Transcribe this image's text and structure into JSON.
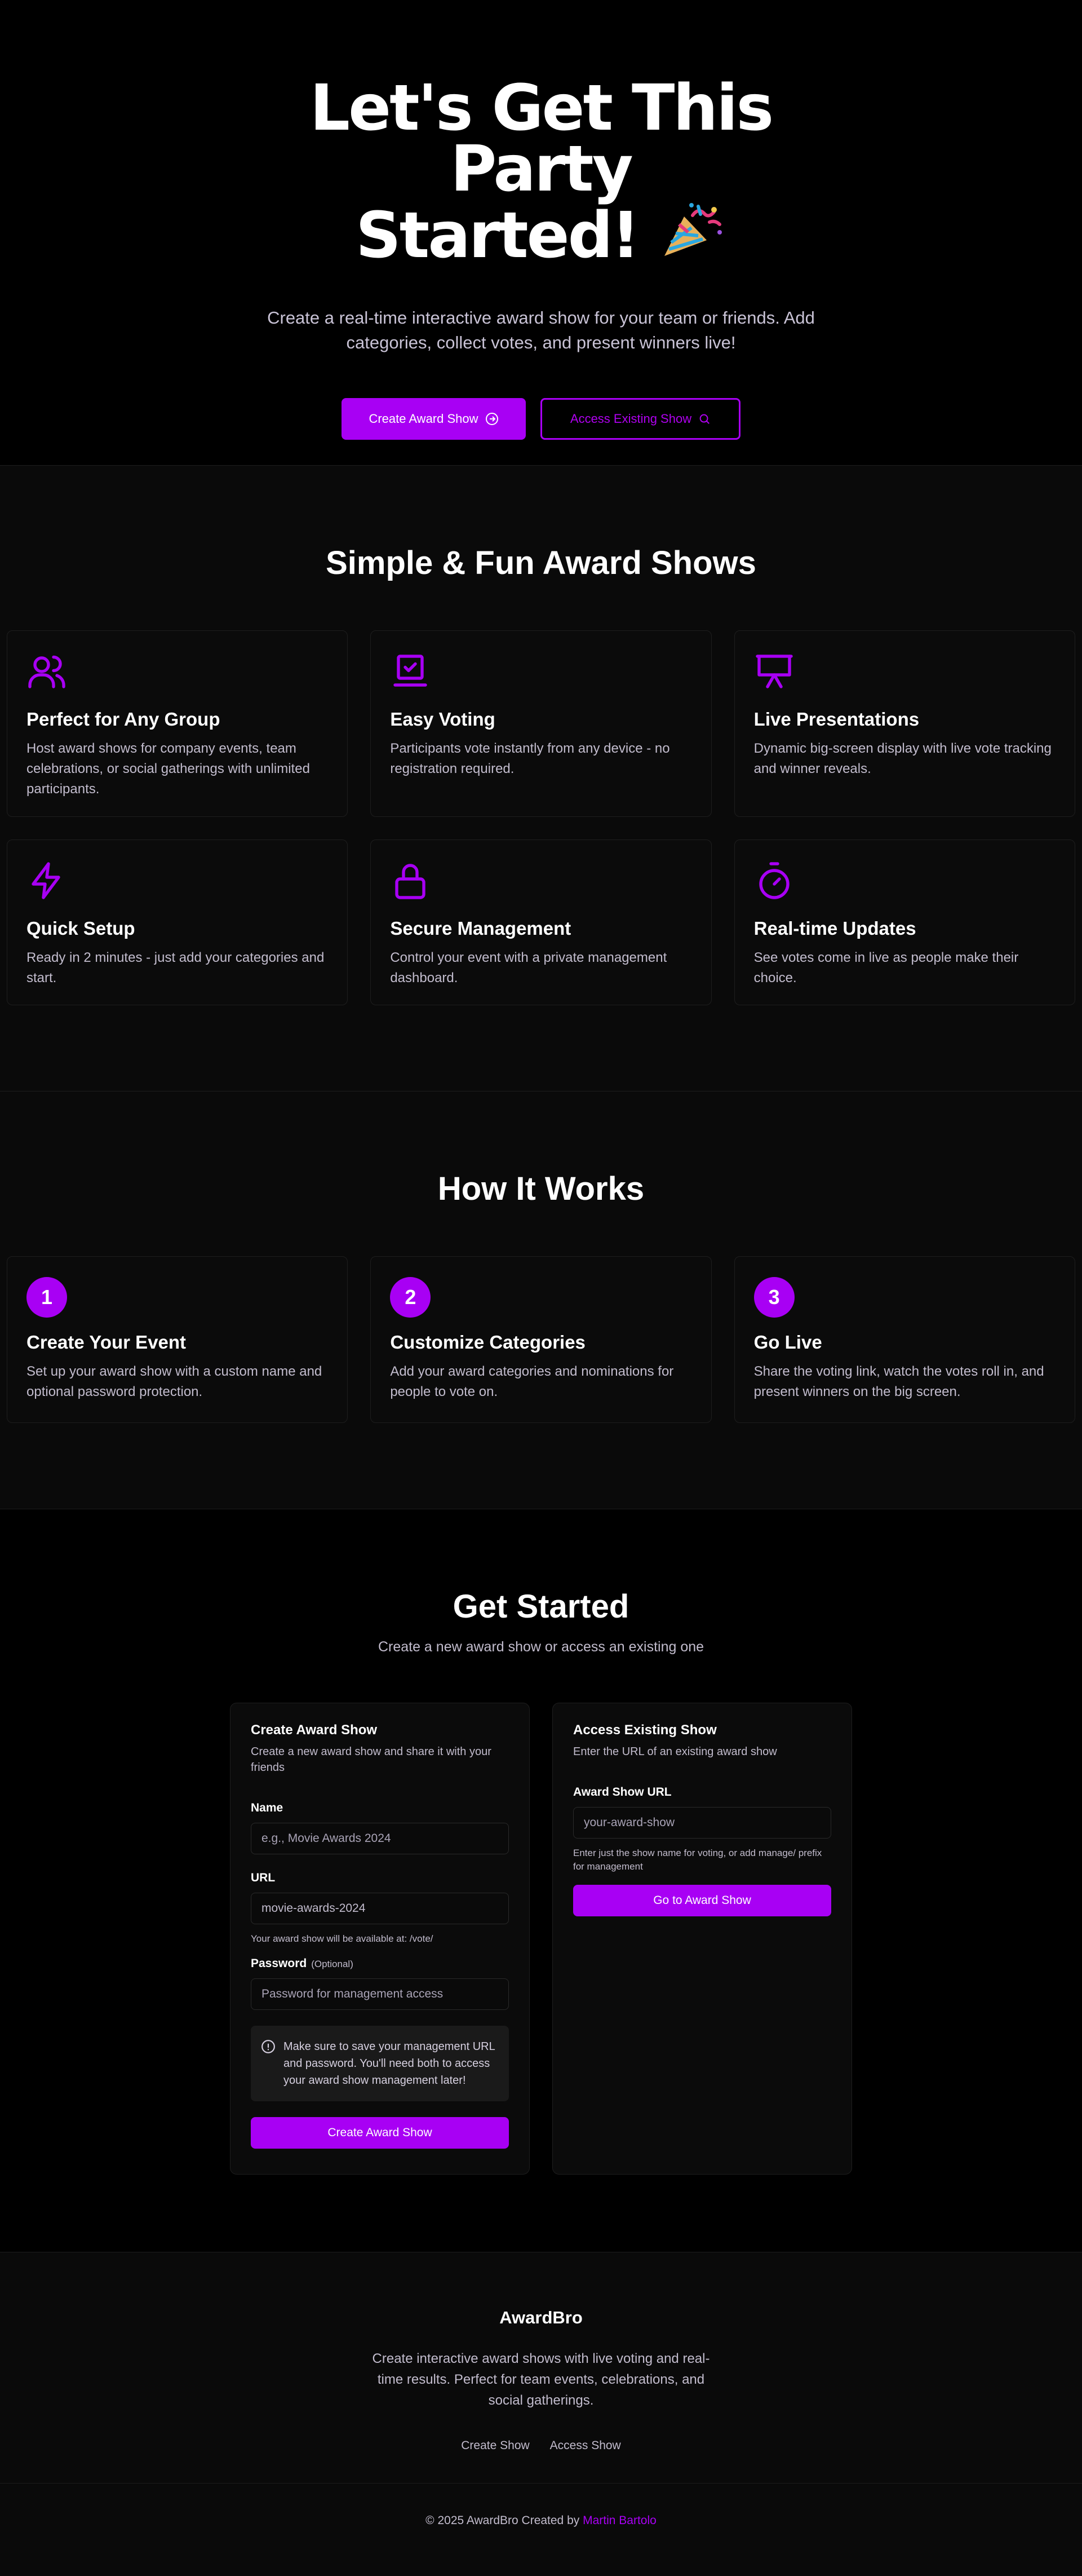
{
  "hero": {
    "title_line1": "Let's Get This Party",
    "title_line2": "Started!",
    "subtitle": "Create a real-time interactive award show for your team or friends. Add categories, collect votes, and present winners live!",
    "primary_button": "Create Award Show",
    "secondary_button": "Access Existing Show"
  },
  "features": {
    "title": "Simple & Fun Award Shows",
    "items": [
      {
        "icon": "users-icon",
        "title": "Perfect for Any Group",
        "text": "Host award shows for company events, team celebrations, or social gatherings with unlimited participants."
      },
      {
        "icon": "vote-laptop-icon",
        "title": "Easy Voting",
        "text": "Participants vote instantly from any device - no registration required."
      },
      {
        "icon": "presentation-icon",
        "title": "Live Presentations",
        "text": "Dynamic big-screen display with live vote tracking and winner reveals."
      },
      {
        "icon": "zap-icon",
        "title": "Quick Setup",
        "text": "Ready in 2 minutes - just add your categories and start."
      },
      {
        "icon": "lock-icon",
        "title": "Secure Management",
        "text": "Control your event with a private management dashboard."
      },
      {
        "icon": "timer-icon",
        "title": "Real-time Updates",
        "text": "See votes come in live as people make their choice."
      }
    ]
  },
  "how": {
    "title": "How It Works",
    "steps": [
      {
        "num": "1",
        "title": "Create Your Event",
        "text": "Set up your award show with a custom name and optional password protection."
      },
      {
        "num": "2",
        "title": "Customize Categories",
        "text": "Add your award categories and nominations for people to vote on."
      },
      {
        "num": "3",
        "title": "Go Live",
        "text": "Share the voting link, watch the votes roll in, and present winners on the big screen."
      }
    ]
  },
  "start": {
    "title": "Get Started",
    "lead": "Create a new award show or access an existing one",
    "create": {
      "heading": "Create Award Show",
      "desc": "Create a new award show and share it with your friends",
      "name_label": "Name",
      "name_placeholder": "e.g., Movie Awards 2024",
      "url_label": "URL",
      "url_value": "movie-awards-2024",
      "url_hint": "Your award show will be available at: /vote/",
      "password_label": "Password",
      "password_optional": "(Optional)",
      "password_placeholder": "Password for management access",
      "alert": "Make sure to save your management URL and password. You'll need both to access your award show management later!",
      "submit": "Create Award Show"
    },
    "access": {
      "heading": "Access Existing Show",
      "desc": "Enter the URL of an existing award show",
      "url_label": "Award Show URL",
      "url_placeholder": "your-award-show",
      "hint": "Enter just the show name for voting, or add manage/ prefix for management",
      "submit": "Go to Award Show"
    }
  },
  "footer": {
    "brand": "AwardBro",
    "about": "Create interactive award shows with live voting and real-time results. Perfect for team events, celebrations, and social gatherings.",
    "link_create": "Create Show",
    "link_access": "Access Show",
    "copyright": "© 2025 AwardBro Created by",
    "author": "Martin Bartolo"
  },
  "colors": {
    "accent": "#a800f4",
    "background": "#000000",
    "surface": "#0a0a0a"
  }
}
